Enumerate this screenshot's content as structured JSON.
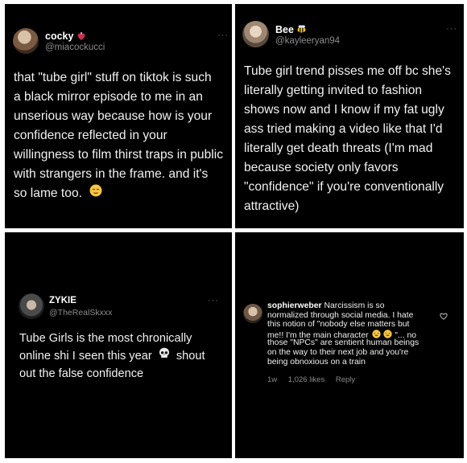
{
  "posts": [
    {
      "username": "cocky",
      "handle": "@miacockucci",
      "more": "···",
      "lines": [
        "that \"tube girl\" stuff on tiktok is such",
        "a black mirror episode to me in an",
        "unserious way because how is your",
        "confidence reflected in your",
        "willingness to film thirst traps in public",
        "with strangers in the frame. and it's",
        "so lame too."
      ],
      "icons": [
        "anatomical-heart-icon",
        "relieved-face-icon"
      ]
    },
    {
      "username": "Bee",
      "handle": "@kayleeryan94",
      "more": "···",
      "lines": [
        "Tube girl trend pisses me off bc she's",
        "literally getting invited to fashion",
        "shows now and I know if my fat ugly",
        "ass tried making a video like that I'd",
        "literally get death threats (I'm mad",
        "because society only favors",
        "\"confidence\" if you're conventionally",
        "attractive)"
      ],
      "icons": [
        "bee-icon"
      ]
    },
    {
      "username": "ZYKIE",
      "handle": "@TheRealSkxxx",
      "more": "···",
      "lines": [
        "Tube Girls is the most chronically",
        "online shi I seen this year",
        "out the false confidence"
      ],
      "line2_tail": "shout",
      "icons": [
        "skull-icon"
      ]
    },
    {
      "username": "sophierweber",
      "lines": [
        "Narcissism is so",
        "normalized through social media. I hate",
        "this notion of \"nobody else matters but",
        "me!! I'm the main character",
        "\"... no",
        "those \"NPCs\" are sentient human beings",
        "on the way to their next job and you're",
        "being obnoxious on a train"
      ],
      "meta": {
        "age": "1w",
        "likes": "1,026 likes",
        "reply": "Reply"
      },
      "icons": [
        "laughing-face-icon",
        "heart-outline-icon"
      ]
    }
  ]
}
